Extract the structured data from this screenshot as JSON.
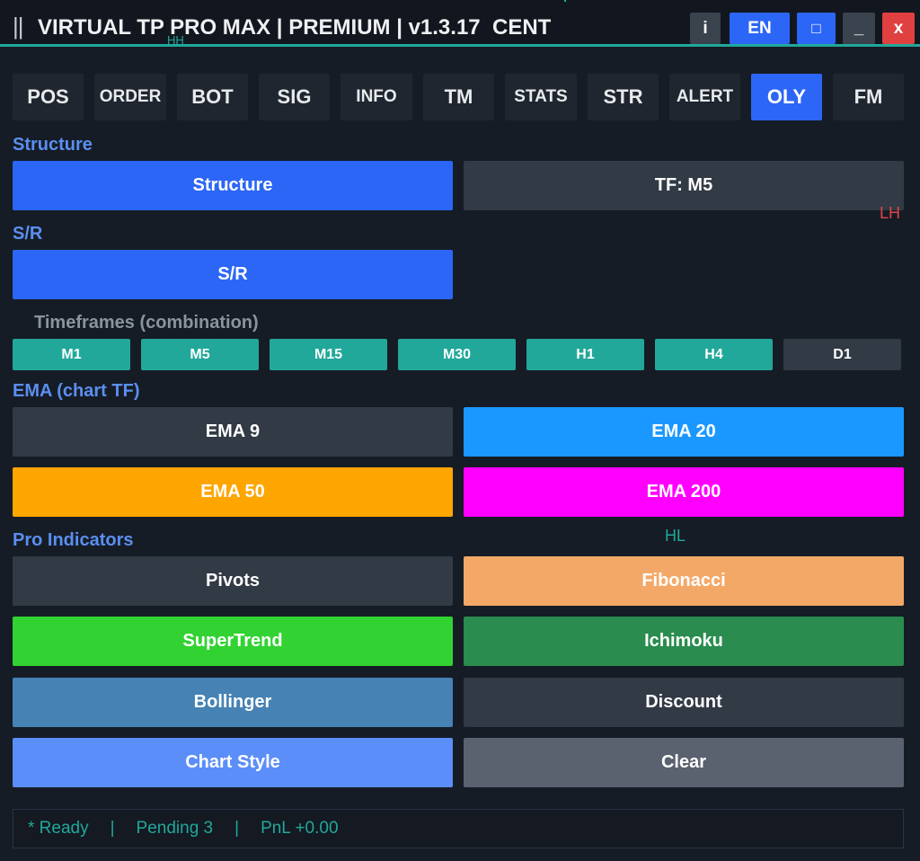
{
  "window": {
    "grip": "||",
    "title": "VIRTUAL TP PRO MAX | PREMIUM | v1.3.17  CENT",
    "overlay_hh": "HH",
    "buttons": {
      "info": "i",
      "lang": "EN",
      "restore": "□",
      "minimize": "_",
      "close": "x"
    }
  },
  "tabs": [
    "POS",
    "ORDER",
    "BOT",
    "SIG",
    "INFO",
    "TM",
    "STATS",
    "STR",
    "ALERT",
    "OLY",
    "FM"
  ],
  "active_tab": "OLY",
  "structure": {
    "heading": "Structure",
    "toggle": "Structure",
    "timeframe": "TF: M5"
  },
  "sr": {
    "heading": "S/R",
    "toggle": "S/R",
    "timeframes_heading": "Timeframes (combination)",
    "timeframes": [
      "M1",
      "M5",
      "M15",
      "M30",
      "H1",
      "H4",
      "D1"
    ]
  },
  "ema": {
    "heading": "EMA (chart TF)",
    "ema9": "EMA 9",
    "ema20": "EMA 20",
    "ema50": "EMA 50",
    "ema200": "EMA 200"
  },
  "pro": {
    "heading": "Pro Indicators",
    "pivots": "Pivots",
    "fibonacci": "Fibonacci",
    "supertrend": "SuperTrend",
    "ichimoku": "Ichimoku",
    "bollinger": "Bollinger",
    "discount": "Discount",
    "chart_style": "Chart Style",
    "clear": "Clear"
  },
  "markers": {
    "lh": "LH",
    "hl": "HL"
  },
  "status": {
    "ready": "* Ready",
    "sep": "|",
    "pending": "Pending 3",
    "pnl": "PnL +0.00"
  },
  "colors": {
    "accent": "#2c66f6",
    "teal": "#21a89a",
    "ema20": "#1a98ff",
    "ema50": "#ffa500",
    "ema200": "#ff00ff",
    "fibonacci": "#f4a868",
    "supertrend": "#32d232",
    "ichimoku": "#2a8c4e",
    "bollinger": "#4682b4",
    "chart_style": "#5b8ef8",
    "clear": "#5a6270"
  }
}
